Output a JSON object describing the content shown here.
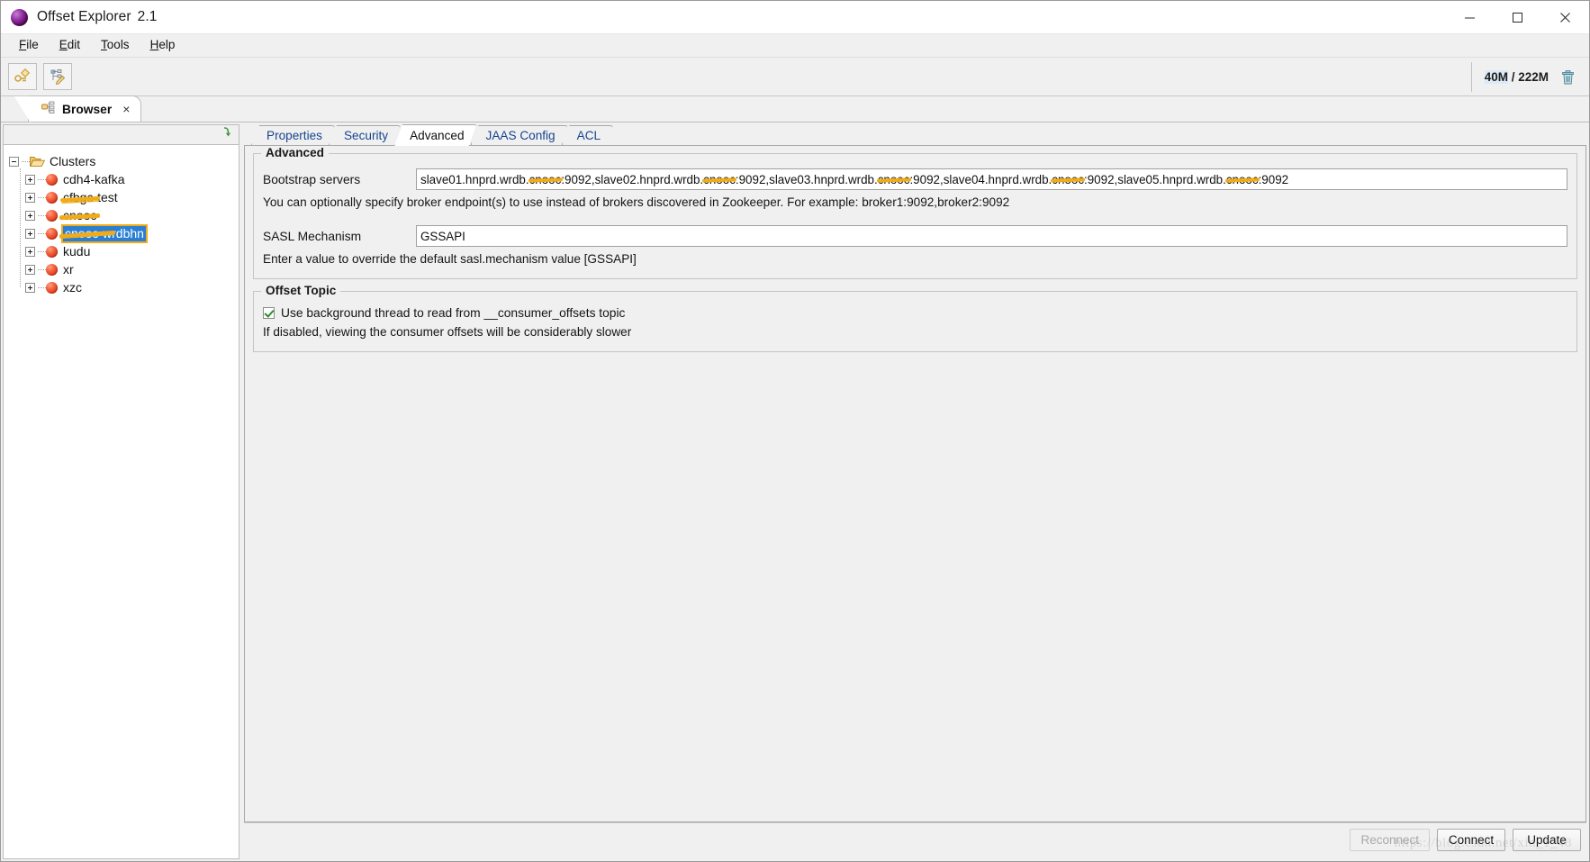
{
  "window": {
    "title": "Offset Explorer",
    "version": "2.1",
    "minimize": "minimize-icon",
    "maximize": "maximize-icon",
    "close": "close-icon"
  },
  "menubar": {
    "items": [
      {
        "label": "File",
        "mnemonic": "F"
      },
      {
        "label": "Edit",
        "mnemonic": "E"
      },
      {
        "label": "Tools",
        "mnemonic": "T"
      },
      {
        "label": "Help",
        "mnemonic": "H"
      }
    ]
  },
  "toolbar": {
    "buttons": [
      {
        "name": "add-cluster-icon"
      },
      {
        "name": "edit-cluster-icon"
      }
    ],
    "memory": "40M / 222M",
    "memory_used": "40M",
    "memory_rest": " / 222M",
    "trash_icon": "trash-icon"
  },
  "browser_tab": {
    "label": "Browser",
    "close": "×",
    "icon": "browser-tree-icon"
  },
  "tree": {
    "collapse_all_icon": "collapse-all-arrow-icon",
    "root": {
      "label": "Clusters",
      "expander": "minus"
    },
    "items": [
      {
        "label": "cdh4-kafka",
        "redacted": "none",
        "selected": false
      },
      {
        "label": "cfbgc-test",
        "redacted": "partial",
        "selected": false
      },
      {
        "label": "cnooc",
        "redacted": "full",
        "selected": false
      },
      {
        "label": "cnooc-wrdbhn",
        "redacted": "partial",
        "selected": true
      },
      {
        "label": "kudu",
        "redacted": "none",
        "selected": false
      },
      {
        "label": "xr",
        "redacted": "none",
        "selected": false
      },
      {
        "label": "xzc",
        "redacted": "none",
        "selected": false
      }
    ]
  },
  "tabs": [
    {
      "label": "Properties",
      "active": false
    },
    {
      "label": "Security",
      "active": false
    },
    {
      "label": "Advanced",
      "active": true
    },
    {
      "label": "JAAS Config",
      "active": false
    },
    {
      "label": "ACL",
      "active": false
    }
  ],
  "advanced": {
    "legend": "Advanced",
    "bootstrap_label": "Bootstrap servers",
    "bootstrap_value": "slave01.hnprd.wrdb.cnooc:9092, slave02.hnprd.wrdb.cnooc:9092, slave03.hnprd.wrdb.cnooc:9092, slave04.hnprd.wrdb.cnooc:9092, slave05.hnprd.wrdb.cnooc:9092",
    "bootstrap_servers": [
      {
        "prefix": "slave01.hnprd.wrdb.",
        "redacted": "cnooc",
        "suffix": ":9092, "
      },
      {
        "prefix": "slave02.hnprd.wrdb.",
        "redacted": "cnooc",
        "suffix": ":9092, "
      },
      {
        "prefix": "slave03.hnprd.wrdb.",
        "redacted": "cnooc",
        "suffix": ":9092, "
      },
      {
        "prefix": "slave04.hnprd.wrdb.",
        "redacted": "cnooc",
        "suffix": ":9092, "
      },
      {
        "prefix": "slave05.hnprd.wrdb.",
        "redacted": "cnooc",
        "suffix": ":9092"
      }
    ],
    "bootstrap_hint": "You can optionally specify broker endpoint(s) to use instead of brokers discovered in Zookeeper. For example: broker1:9092,broker2:9092",
    "sasl_label": "SASL Mechanism",
    "sasl_value": "GSSAPI",
    "sasl_hint": "Enter a value to override the default sasl.mechanism value [GSSAPI]"
  },
  "offset_topic": {
    "legend": "Offset Topic",
    "checkbox_label": "Use background thread to read from __consumer_offsets topic",
    "checkbox_checked": true,
    "hint": "If disabled, viewing the consumer offsets will be considerably slower"
  },
  "buttons": {
    "reconnect": "Reconnect",
    "connect": "Connect",
    "update": "Update",
    "reconnect_disabled": true
  },
  "watermark": "https://blog.csdn.net/xin_1_48",
  "colors": {
    "accent_blue": "#2a7fd4",
    "redaction": "#f0ab17",
    "tab_text": "#16448f",
    "cluster_red": "#e23a1c"
  }
}
